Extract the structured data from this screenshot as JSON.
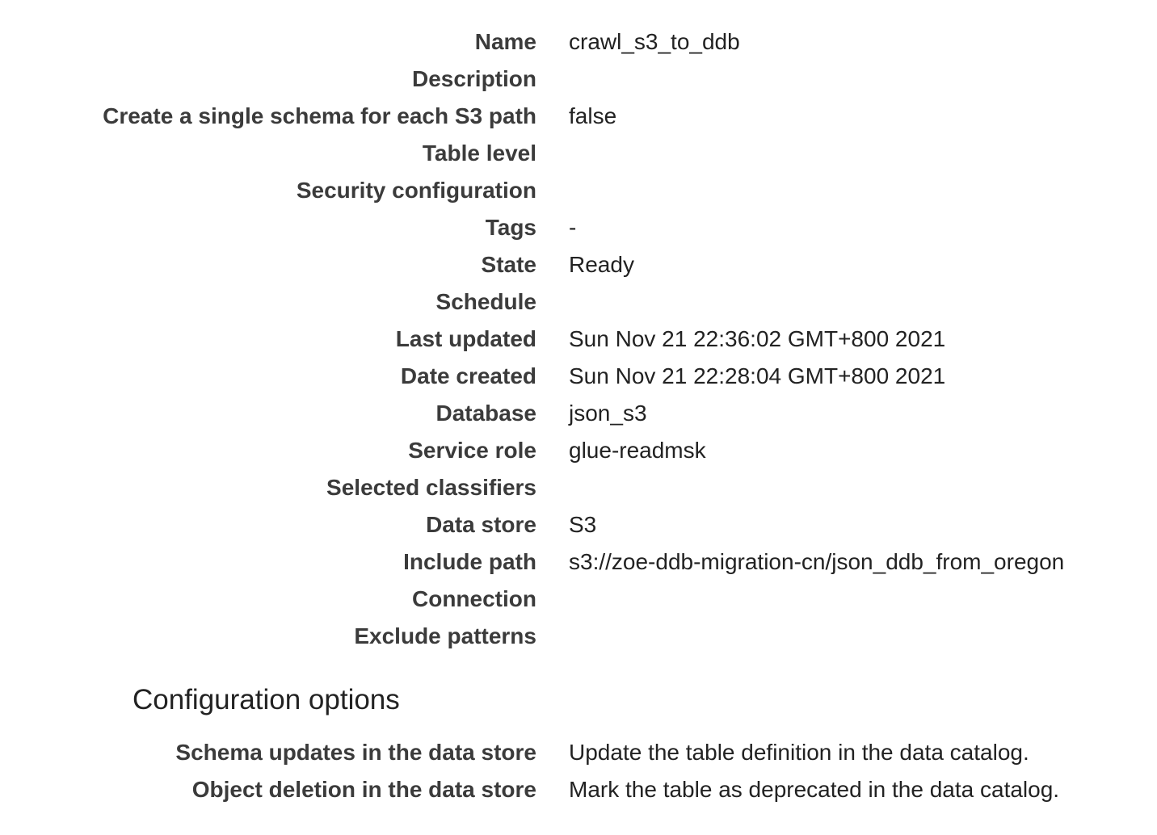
{
  "details": [
    {
      "label": "Name",
      "value": "crawl_s3_to_ddb"
    },
    {
      "label": "Description",
      "value": ""
    },
    {
      "label": "Create a single schema for each S3 path",
      "value": "false"
    },
    {
      "label": "Table level",
      "value": ""
    },
    {
      "label": "Security configuration",
      "value": ""
    },
    {
      "label": "Tags",
      "value": "-"
    },
    {
      "label": "State",
      "value": "Ready"
    },
    {
      "label": "Schedule",
      "value": ""
    },
    {
      "label": "Last updated",
      "value": "Sun Nov 21 22:36:02 GMT+800 2021"
    },
    {
      "label": "Date created",
      "value": "Sun Nov 21 22:28:04 GMT+800 2021"
    },
    {
      "label": "Database",
      "value": "json_s3"
    },
    {
      "label": "Service role",
      "value": "glue-readmsk"
    },
    {
      "label": "Selected classifiers",
      "value": ""
    },
    {
      "label": "Data store",
      "value": "S3"
    },
    {
      "label": "Include path",
      "value": "s3://zoe-ddb-migration-cn/json_ddb_from_oregon"
    },
    {
      "label": "Connection",
      "value": ""
    },
    {
      "label": "Exclude patterns",
      "value": ""
    }
  ],
  "config_section": {
    "title": "Configuration options",
    "rows": [
      {
        "label": "Schema updates in the data store",
        "value": "Update the table definition in the data catalog."
      },
      {
        "label": "Object deletion in the data store",
        "value": "Mark the table as deprecated in the data catalog."
      }
    ]
  }
}
